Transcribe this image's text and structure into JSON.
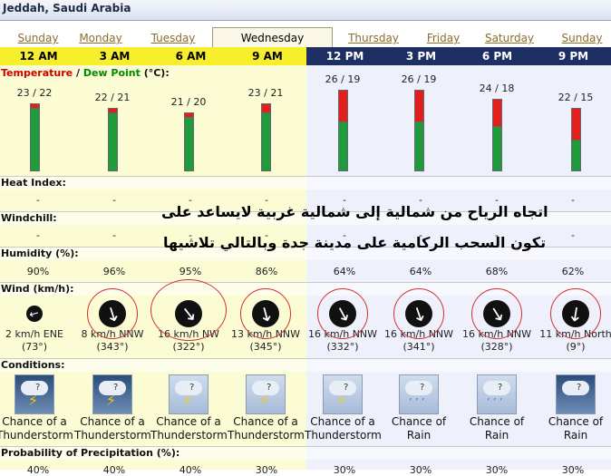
{
  "header": {
    "location": "Jeddah, Saudi Arabia"
  },
  "days": [
    {
      "label": "Sunday",
      "active": false
    },
    {
      "label": "Monday",
      "active": false
    },
    {
      "label": "Tuesday",
      "active": false
    },
    {
      "label": "Wednesday",
      "active": true
    },
    {
      "label": "Thursday",
      "active": false
    },
    {
      "label": "Friday",
      "active": false
    },
    {
      "label": "Saturday",
      "active": false
    },
    {
      "label": "Sunday",
      "active": false
    }
  ],
  "times": [
    "12 AM",
    "3 AM",
    "6 AM",
    "9 AM",
    "12 PM",
    "3 PM",
    "6 PM",
    "9 PM"
  ],
  "sections": {
    "temperature": "Temperature",
    "slash": " / ",
    "dew_point": "Dew Point",
    "temp_unit": " (°C):",
    "heat_index": "Heat Index:",
    "windchill": "Windchill:",
    "humidity": "Humidity (%):",
    "wind": "Wind (km/h):",
    "conditions": "Conditions:",
    "precip": "Probability of Precipitation (%):"
  },
  "temps": [
    {
      "temp": 23,
      "dew": 22,
      "label": "23 / 22"
    },
    {
      "temp": 22,
      "dew": 21,
      "label": "22 / 21"
    },
    {
      "temp": 21,
      "dew": 20,
      "label": "21 / 20"
    },
    {
      "temp": 23,
      "dew": 21,
      "label": "23 / 21"
    },
    {
      "temp": 26,
      "dew": 19,
      "label": "26 / 19"
    },
    {
      "temp": 26,
      "dew": 19,
      "label": "26 / 19"
    },
    {
      "temp": 24,
      "dew": 18,
      "label": "24 / 18"
    },
    {
      "temp": 22,
      "dew": 15,
      "label": "22 / 15"
    }
  ],
  "heat_index": [
    "-",
    "-",
    "-",
    "-",
    "-",
    "-",
    "-",
    "-"
  ],
  "windchill": [
    "-",
    "-",
    "-",
    "-",
    "-",
    "-",
    "-",
    "-"
  ],
  "humidity": [
    "90%",
    "96%",
    "95%",
    "86%",
    "64%",
    "64%",
    "68%",
    "62%"
  ],
  "wind": [
    {
      "speed": "2 km/h ENE",
      "deg": "(73°)"
    },
    {
      "speed": "8 km/h NNW",
      "deg": "(343°)"
    },
    {
      "speed": "16 km/h NW",
      "deg": "(322°)"
    },
    {
      "speed": "13 km/h NNW",
      "deg": "(345°)"
    },
    {
      "speed": "16 km/h NNW",
      "deg": "(332°)"
    },
    {
      "speed": "16 km/h NNW",
      "deg": "(341°)"
    },
    {
      "speed": "16 km/h NNW",
      "deg": "(328°)"
    },
    {
      "speed": "11 km/h North",
      "deg": "(9°)"
    }
  ],
  "conditions": [
    {
      "line1": "Chance of a",
      "line2": "Thunderstorm",
      "icon": "thunderstorm-icon"
    },
    {
      "line1": "Chance of a",
      "line2": "Thunderstorm",
      "icon": "thunderstorm-icon"
    },
    {
      "line1": "Chance of a",
      "line2": "Thunderstorm",
      "icon": "thunderstorm-icon"
    },
    {
      "line1": "Chance of a",
      "line2": "Thunderstorm",
      "icon": "thunderstorm-icon"
    },
    {
      "line1": "Chance of a",
      "line2": "Thunderstorm",
      "icon": "thunderstorm-icon"
    },
    {
      "line1": "Chance of",
      "line2": "Rain",
      "icon": "rain-icon"
    },
    {
      "line1": "Chance of",
      "line2": "Rain",
      "icon": "rain-icon"
    },
    {
      "line1": "Chance of",
      "line2": "Rain",
      "icon": "rain-icon"
    }
  ],
  "precip": [
    "40%",
    "40%",
    "40%",
    "30%",
    "30%",
    "30%",
    "30%",
    "30%"
  ],
  "annotation": {
    "line1": "اتجاه الرياح من شمالية إلى شمالية غربية لايساعد على",
    "line2": "تكون السحب الركامية  على مدينة جدة وبالتالي تلاشيها"
  },
  "colors": {
    "temperature": "#cc0000",
    "dew_point": "#008a00",
    "am_band": "#f8ef2c",
    "pm_band": "#1d2f63",
    "circle": "#d23030"
  }
}
